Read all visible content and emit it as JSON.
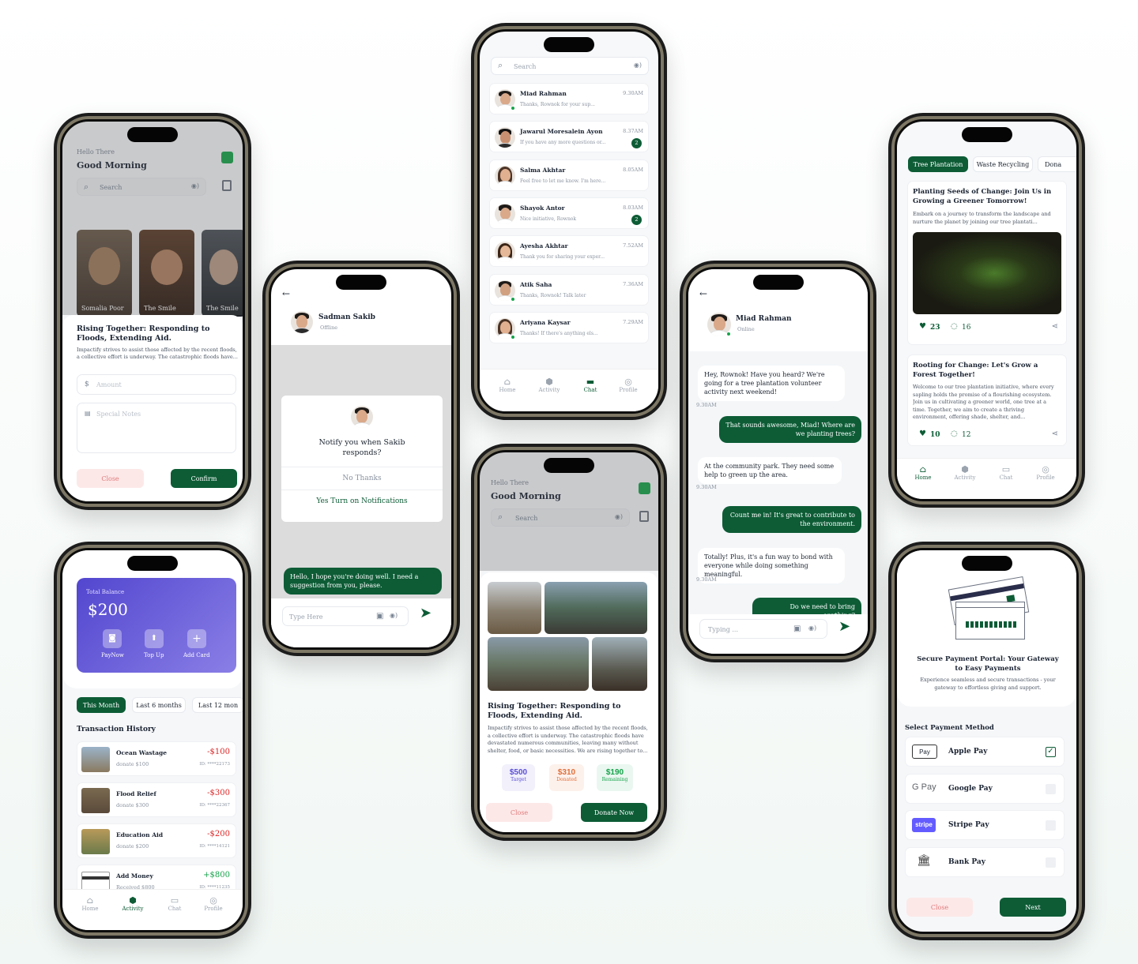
{
  "colors": {
    "brand": "#0d5c36",
    "danger": "#e07a7a",
    "purple": "#5b4fd6"
  },
  "home": {
    "greeting": "Hello There",
    "title": "Good Morning",
    "search_placeholder": "Search",
    "stories": [
      "Somalia Poor",
      "The Smile",
      "The Smile"
    ],
    "sheet_title": "Rising Together: Responding to Floods, Extending Aid.",
    "sheet_desc": "Impactify strives to assist those affected by the recent floods, a collective effort is underway. The catastrophic floods have...",
    "amount_placeholder": "Amount",
    "notes_placeholder": "Special Notes",
    "close": "Close",
    "confirm": "Confirm"
  },
  "notify": {
    "name": "Sadman Sakib",
    "status": "Offline",
    "title": "Notify you when Sakib responds?",
    "no": "No Thanks",
    "yes": "Yes Turn on Notifications",
    "message": "Hello, I hope you're doing well. I need a suggestion from you, please.",
    "input_placeholder": "Type Here"
  },
  "chatlist": {
    "search_placeholder": "Search",
    "items": [
      {
        "name": "Miad Rahman",
        "time": "9.30AM",
        "msg": "Thanks, Rownok for your sup...",
        "badge": ""
      },
      {
        "name": "Jawarul Moresalein Ayon",
        "time": "8.37AM",
        "msg": "If you have any more questions or...",
        "badge": "2"
      },
      {
        "name": "Salma Akhtar",
        "time": "8.05AM",
        "msg": "Feel free to let me know. I'm here...",
        "badge": ""
      },
      {
        "name": "Shayok Antor",
        "time": "8.03AM",
        "msg": "Nice initiative, Rownok",
        "badge": "2"
      },
      {
        "name": "Ayesha Akhtar",
        "time": "7.52AM",
        "msg": "Thank you for sharing your exper...",
        "badge": ""
      },
      {
        "name": "Atik Saha",
        "time": "7.36AM",
        "msg": "Thanks, Rownok! Talk later",
        "badge": ""
      },
      {
        "name": "Ariyana Kaysar",
        "time": "7.29AM",
        "msg": "Thanks! If there's anything els...",
        "badge": ""
      }
    ],
    "nav": [
      "Home",
      "Activity",
      "Chat",
      "Profile"
    ]
  },
  "wallet": {
    "balance_label": "Total Balance",
    "balance": "$200",
    "actions": [
      "PayNow",
      "Top Up",
      "Add Card"
    ],
    "filters": [
      "This Month",
      "Last 6 months",
      "Last 12 mon"
    ],
    "history_title": "Transaction History",
    "transactions": [
      {
        "title": "Ocean Wastage",
        "sub": "donate $100",
        "amount": "-$100",
        "id": "ID: ****22173"
      },
      {
        "title": "Flood Relief",
        "sub": "donate $300",
        "amount": "-$300",
        "id": "ID: ****22367"
      },
      {
        "title": "Education Aid",
        "sub": "donate $200",
        "amount": "-$200",
        "id": "ID: ****14121"
      },
      {
        "title": "Add Money",
        "sub": "Received $800",
        "amount": "+$800",
        "id": "ID: ****11235"
      }
    ],
    "nav": [
      "Home",
      "Activity",
      "Chat",
      "Profile"
    ]
  },
  "detail": {
    "greeting": "Hello There",
    "title": "Good Morning",
    "search_placeholder": "Search",
    "heading": "Rising Together: Responding to Floods, Extending Aid.",
    "desc": "Impactify strives to assist those affected by the recent floods, a collective effort is underway. The catastrophic floods have devastated numerous communities, leaving many without shelter, food, or basic necessities. We are rising together to...",
    "stats": [
      {
        "value": "$500",
        "label": "Target"
      },
      {
        "value": "$310",
        "label": "Donated"
      },
      {
        "value": "$190",
        "label": "Remaining"
      }
    ],
    "close": "Close",
    "donate": "Donate Now"
  },
  "conversation": {
    "name": "Miad Rahman",
    "status": "Online",
    "messages": [
      {
        "from": "in",
        "text": "Hey, Rownok! Have you heard? We're going for a tree plantation volunteer activity next weekend!",
        "time": "9.30AM"
      },
      {
        "from": "out",
        "text": "That sounds awesome, Miad! Where are we planting trees?"
      },
      {
        "from": "in",
        "text": "At the community park. They need some help to green up the area.",
        "time": "9.30AM"
      },
      {
        "from": "out",
        "text": "Count me in! It's great to contribute to the environment."
      },
      {
        "from": "in",
        "text": "Totally! Plus, it's a fun way to bond with everyone while doing something meaningful.",
        "time": "9.30AM"
      },
      {
        "from": "out",
        "text": "Do we need to bring anything?"
      }
    ],
    "input_placeholder": "Typing ..."
  },
  "feed": {
    "tabs": [
      "Tree Plantation",
      "Waste Recycling",
      "Dona"
    ],
    "post1": {
      "title": "Planting Seeds of Change: Join Us in Growing a Greener Tomorrow!",
      "desc": "Embark on a journey to transform the landscape and nurture the planet by joining our tree plantati...",
      "likes": "23",
      "comments": "16"
    },
    "post2": {
      "title": "Rooting for Change: Let's Grow a Forest Together!",
      "desc": "Welcome to our tree plantation initiative, where every sapling holds the promise of a flourishing ecosystem. Join us in cultivating a greener world, one tree at a time. Together, we aim to create a thriving environment, offering shade, shelter, and...",
      "likes": "10",
      "comments": "12"
    },
    "nav": [
      "Home",
      "Activity",
      "Chat",
      "Profile"
    ]
  },
  "payment": {
    "title": "Secure Payment Portal: Your Gateway to Easy Payments",
    "desc": "Experience seamless and secure transactions - your gateway to effortless giving and support.",
    "section": "Select Payment Method",
    "methods": [
      {
        "name": "Apple Pay",
        "logo": "Pay",
        "checked": true
      },
      {
        "name": "Google Pay",
        "logo": "G Pay",
        "checked": false
      },
      {
        "name": "Stripe Pay",
        "logo": "stripe",
        "checked": false
      },
      {
        "name": "Bank Pay",
        "logo": "bank-icon",
        "checked": false
      }
    ],
    "close": "Close",
    "next": "Next"
  }
}
